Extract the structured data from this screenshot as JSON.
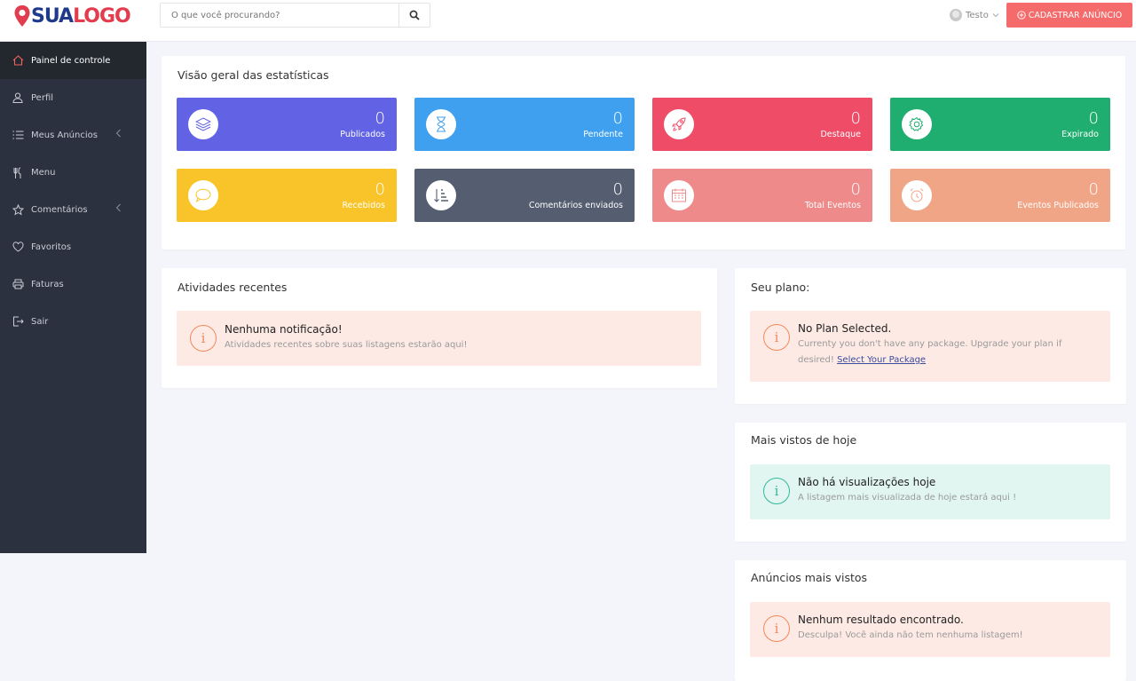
{
  "brand": {
    "logo_part1": "SUA",
    "logo_part2": "LOGO"
  },
  "header": {
    "search_placeholder": "O que você procurando?",
    "user_name": "Testo",
    "cta_label": "CADASTRAR ANÚNCIO"
  },
  "sidebar": {
    "items": [
      {
        "label": "Painel de controle",
        "icon": "home-icon"
      },
      {
        "label": "Perfil",
        "icon": "user-icon"
      },
      {
        "label": "Meus Anúncios",
        "icon": "list-icon"
      },
      {
        "label": "Menu",
        "icon": "cutlery-icon"
      },
      {
        "label": "Comentários",
        "icon": "star-icon"
      },
      {
        "label": "Favoritos",
        "icon": "heart-icon"
      },
      {
        "label": "Faturas",
        "icon": "printer-icon"
      },
      {
        "label": "Sair",
        "icon": "logout-icon"
      }
    ]
  },
  "stats": {
    "title": "Visão geral das estatísticas",
    "items": [
      {
        "value": "0",
        "label": "Publicados",
        "color": "#6163e4",
        "icon": "layers-icon"
      },
      {
        "value": "0",
        "label": "Pendente",
        "color": "#3ea0ef",
        "icon": "hourglass-icon"
      },
      {
        "value": "0",
        "label": "Destaque",
        "color": "#ee4c67",
        "icon": "rocket-icon"
      },
      {
        "value": "0",
        "label": "Expirado",
        "color": "#1fae6f",
        "icon": "gear-icon"
      },
      {
        "value": "0",
        "label": "Recebidos",
        "color": "#f8c429",
        "icon": "chat-icon"
      },
      {
        "value": "0",
        "label": "Comentários enviados",
        "color": "#545e70",
        "icon": "sort-icon"
      },
      {
        "value": "0",
        "label": "Total Eventos",
        "color": "#ee8a89",
        "icon": "calendar-icon"
      },
      {
        "value": "0",
        "label": "Eventos Publicados",
        "color": "#f1a587",
        "icon": "alarm-icon"
      }
    ]
  },
  "recent": {
    "title": "Atividades recentes",
    "notice_title": "Nenhuma notificação!",
    "notice_desc": "Atividades recentes sobre suas listagens estarão aqui!"
  },
  "plan": {
    "title": "Seu plano:",
    "notice_title": "No Plan Selected.",
    "notice_desc_line1": "Currenty you don't have any package. Upgrade your plan if",
    "notice_desc_line2": "desired!",
    "link_label": "Select Your Package"
  },
  "today": {
    "title": "Mais vistos de hoje",
    "notice_title": "Não há visualizações hoje",
    "notice_desc": "A listagem mais visualizada de hoje estará aqui !"
  },
  "most_viewed": {
    "title": "Anúncios mais vistos",
    "notice_title": "Nenhum resultado encontrado.",
    "notice_desc": "Desculpa! Você ainda não tem nenhuma listagem!"
  },
  "colors": {
    "sidebar_bg": "#2b313e",
    "cta_bg": "#f56a6a",
    "warn_bg": "#fdeae4",
    "warn_accent": "#ef8a5c",
    "info_bg": "#e2f6f1",
    "info_accent": "#33b89a"
  }
}
